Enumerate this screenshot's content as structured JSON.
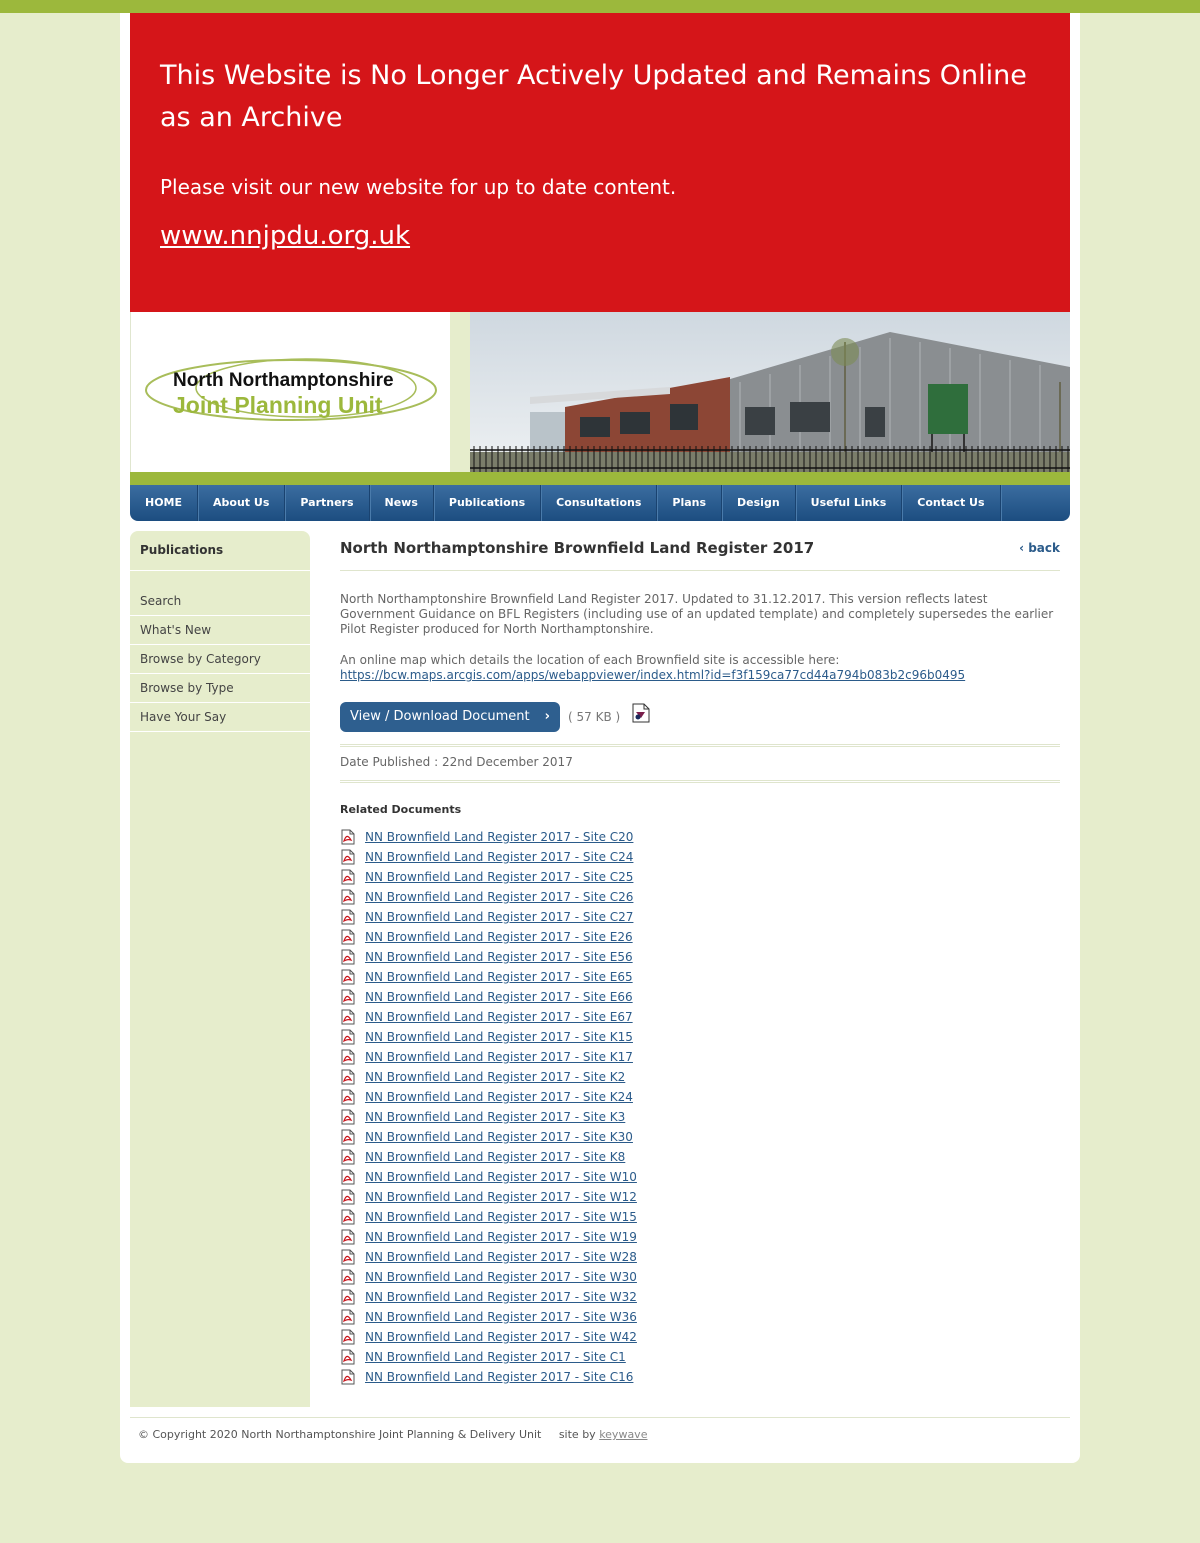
{
  "archive": {
    "title": "This Website is No Longer Actively Updated and Remains Online as an Archive",
    "subtitle": "Please visit our new website for up to date content.",
    "link": "www.nnjpdu.org.uk"
  },
  "logo": {
    "line1": "North Northamptonshire",
    "line2": "Joint Planning Unit"
  },
  "nav": [
    "HOME",
    "About Us",
    "Partners",
    "News",
    "Publications",
    "Consultations",
    "Plans",
    "Design",
    "Useful Links",
    "Contact Us"
  ],
  "sidebar": {
    "heading": "Publications",
    "items": [
      "Search",
      "What's New",
      "Browse by Category",
      "Browse by Type",
      "Have Your Say"
    ]
  },
  "content": {
    "title": "North Northamptonshire Brownfield Land Register 2017",
    "back": "back",
    "description": "North Northamptonshire Brownfield Land Register 2017. Updated to 31.12.2017. This version reflects latest Government Guidance on BFL Registers (including use of an updated template) and completely supersedes the earlier Pilot Register produced for North Northamptonshire.",
    "map_intro": "An online map which details the location of each Brownfield site is accessible here:",
    "map_link": "https://bcw.maps.arcgis.com/apps/webappviewer/index.html?id=f3f159ca77cd44a794b083b2c96b0495",
    "download_label": "View / Download Document",
    "file_size": "( 57 KB )",
    "date_published": "Date Published : 22nd December 2017",
    "related_heading": "Related Documents",
    "related": [
      "NN Brownfield Land Register 2017 - Site C20",
      "NN Brownfield Land Register 2017 - Site C24",
      "NN Brownfield Land Register 2017 - Site C25",
      "NN Brownfield Land Register 2017 - Site C26",
      "NN Brownfield Land Register 2017 - Site C27",
      "NN Brownfield Land Register 2017 - Site E26",
      "NN Brownfield Land Register 2017 - Site E56",
      "NN Brownfield Land Register 2017 - Site E65",
      "NN Brownfield Land Register 2017 - Site E66",
      "NN Brownfield Land Register 2017 - Site E67",
      "NN Brownfield Land Register 2017 - Site K15",
      "NN Brownfield Land Register 2017 - Site K17",
      "NN Brownfield Land Register 2017 - Site K2",
      "NN Brownfield Land Register 2017 - Site K24",
      "NN Brownfield Land Register 2017 - Site K3",
      "NN Brownfield Land Register 2017 - Site K30",
      "NN Brownfield Land Register 2017 - Site K8",
      "NN Brownfield Land Register 2017 - Site W10",
      "NN Brownfield Land Register 2017 - Site W12",
      "NN Brownfield Land Register 2017 - Site W15",
      "NN Brownfield Land Register 2017 - Site W19",
      "NN Brownfield Land Register 2017 - Site W28",
      "NN Brownfield Land Register 2017 - Site W30",
      "NN Brownfield Land Register 2017 - Site W32",
      "NN Brownfield Land Register 2017 - Site W36",
      "NN Brownfield Land Register 2017 - Site W42",
      "NN Brownfield Land Register 2017 - Site C1",
      "NN Brownfield Land Register 2017 - Site C16"
    ]
  },
  "footer": {
    "copyright": "© Copyright 2020 North Northamptonshire Joint Planning & Delivery Unit",
    "site_by": "site by",
    "credit": "keywave"
  },
  "colors": {
    "accent_green": "#9cb83c",
    "archive_red": "#d51519",
    "nav_blue": "#2e5f8f",
    "page_bg": "#e6edcc"
  },
  "icons": [
    "chevron-left-icon",
    "chevron-right-icon",
    "document-icon",
    "pdf-icon"
  ]
}
